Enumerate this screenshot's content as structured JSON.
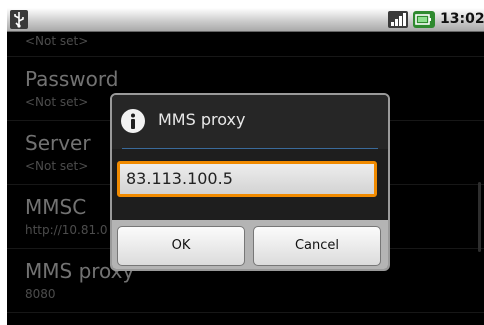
{
  "status_bar": {
    "time": "13:02",
    "icons": [
      "usb-icon",
      "signal-icon",
      "battery-icon"
    ]
  },
  "settings_list": {
    "items": [
      {
        "label": "",
        "value": "<Not set>"
      },
      {
        "label": "Password",
        "value": "<Not set>"
      },
      {
        "label": "Server",
        "value": "<Not set>"
      },
      {
        "label": "MMSC",
        "value": "http://10.81.0"
      },
      {
        "label": "MMS proxy",
        "value": "8080"
      }
    ]
  },
  "dialog": {
    "title": "MMS proxy",
    "icon": "info-icon",
    "input_value": "83.113.100.5",
    "ok_label": "OK",
    "cancel_label": "Cancel"
  },
  "colors": {
    "background": "#000000",
    "input_focus_border": "#f08a00",
    "divider": "#3a6a9a"
  }
}
